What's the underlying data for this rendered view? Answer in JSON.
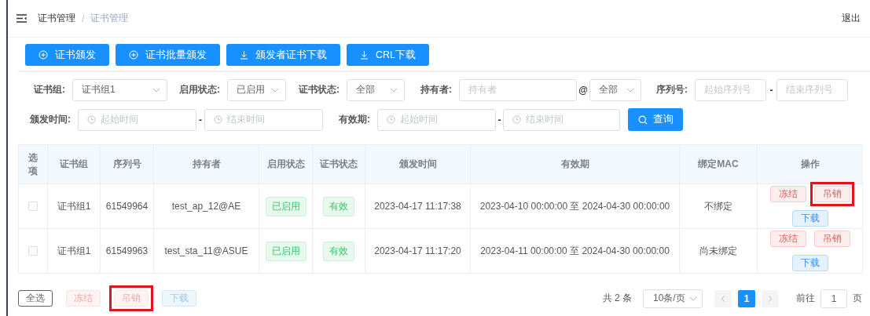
{
  "header": {
    "breadcrumb": [
      {
        "label": "证书管理",
        "current": false
      },
      {
        "label": "证书管理",
        "current": true
      }
    ],
    "separator": "/",
    "logout": "退出"
  },
  "toolbar": [
    {
      "label": "证书颁发",
      "kind": "add"
    },
    {
      "label": "证书批量颁发",
      "kind": "add"
    },
    {
      "label": "颁发者证书下载",
      "kind": "download"
    },
    {
      "label": "CRL下载",
      "kind": "download"
    }
  ],
  "filters": [
    [
      {
        "kind": "label",
        "text": "证书组:"
      },
      {
        "kind": "select",
        "value": "证书组1"
      },
      {
        "kind": "label",
        "text": "启用状态:"
      },
      {
        "kind": "select",
        "value": "已启用"
      },
      {
        "kind": "label",
        "text": "证书状态:"
      },
      {
        "kind": "select",
        "value": "全部"
      },
      {
        "kind": "label",
        "text": "持有者:"
      },
      {
        "kind": "input",
        "placeholder": "持有者"
      },
      {
        "kind": "symbol",
        "text": "@"
      },
      {
        "kind": "select",
        "value": "全部"
      },
      {
        "kind": "label",
        "text": "序列号:"
      },
      {
        "kind": "input",
        "placeholder": "起始序列号"
      },
      {
        "kind": "symbol",
        "text": "-"
      },
      {
        "kind": "input",
        "placeholder": "结束序列号"
      }
    ],
    [
      {
        "kind": "label",
        "text": "颁发时间:"
      },
      {
        "kind": "date",
        "placeholder": "起始时间"
      },
      {
        "kind": "symbol",
        "text": "-"
      },
      {
        "kind": "date",
        "placeholder": "结束时间"
      },
      {
        "kind": "label",
        "text": "有效期:"
      },
      {
        "kind": "date",
        "placeholder": "起始时间"
      },
      {
        "kind": "symbol",
        "text": "-"
      },
      {
        "kind": "date",
        "placeholder": "结束时间"
      },
      {
        "kind": "button",
        "text": "查询"
      }
    ]
  ],
  "table": {
    "columns": [
      "选项",
      "证书组",
      "序列号",
      "持有者",
      "启用状态",
      "证书状态",
      "颁发时间",
      "有效期",
      "绑定MAC",
      "操作"
    ],
    "rows": [
      {
        "checked": false,
        "group": "证书组1",
        "serial": "61549964",
        "holder": "test_ap_12@AE",
        "enable_status": "已启用",
        "cert_status": "有效",
        "issued": "2023-04-17 11:17:38",
        "validity": "2023-04-10 00:00:00 至 2024-04-30 00:00:00",
        "mac": "不绑定",
        "actions": [
          {
            "label": "冻结",
            "kind": "danger",
            "highlighted": false
          },
          {
            "label": "吊销",
            "kind": "danger",
            "highlighted": true
          },
          {
            "label": "下载",
            "kind": "primary",
            "highlighted": false
          }
        ]
      },
      {
        "checked": false,
        "group": "证书组1",
        "serial": "61549963",
        "holder": "test_sta_11@ASUE",
        "enable_status": "已启用",
        "cert_status": "有效",
        "issued": "2023-04-17 11:17:20",
        "validity": "2023-04-11 00:00:00 至 2024-04-30 00:00:00",
        "mac": "尚未绑定",
        "actions": [
          {
            "label": "冻结",
            "kind": "danger",
            "highlighted": false
          },
          {
            "label": "吊销",
            "kind": "danger",
            "highlighted": false
          },
          {
            "label": "下载",
            "kind": "primary",
            "highlighted": false
          }
        ]
      }
    ]
  },
  "footer": {
    "bulk_actions": [
      {
        "label": "全选",
        "kind": "default",
        "disabled": false,
        "highlighted": false
      },
      {
        "label": "冻结",
        "kind": "danger",
        "disabled": true,
        "highlighted": false
      },
      {
        "label": "吊销",
        "kind": "danger",
        "disabled": true,
        "highlighted": true
      },
      {
        "label": "下载",
        "kind": "primary",
        "disabled": true,
        "highlighted": false
      }
    ],
    "total": "共 2 条",
    "page_size": "10条/页",
    "pages": [
      {
        "label": "1",
        "selected": true
      }
    ],
    "goto_label": "前往",
    "goto_value": "1",
    "goto_suffix": "页"
  }
}
